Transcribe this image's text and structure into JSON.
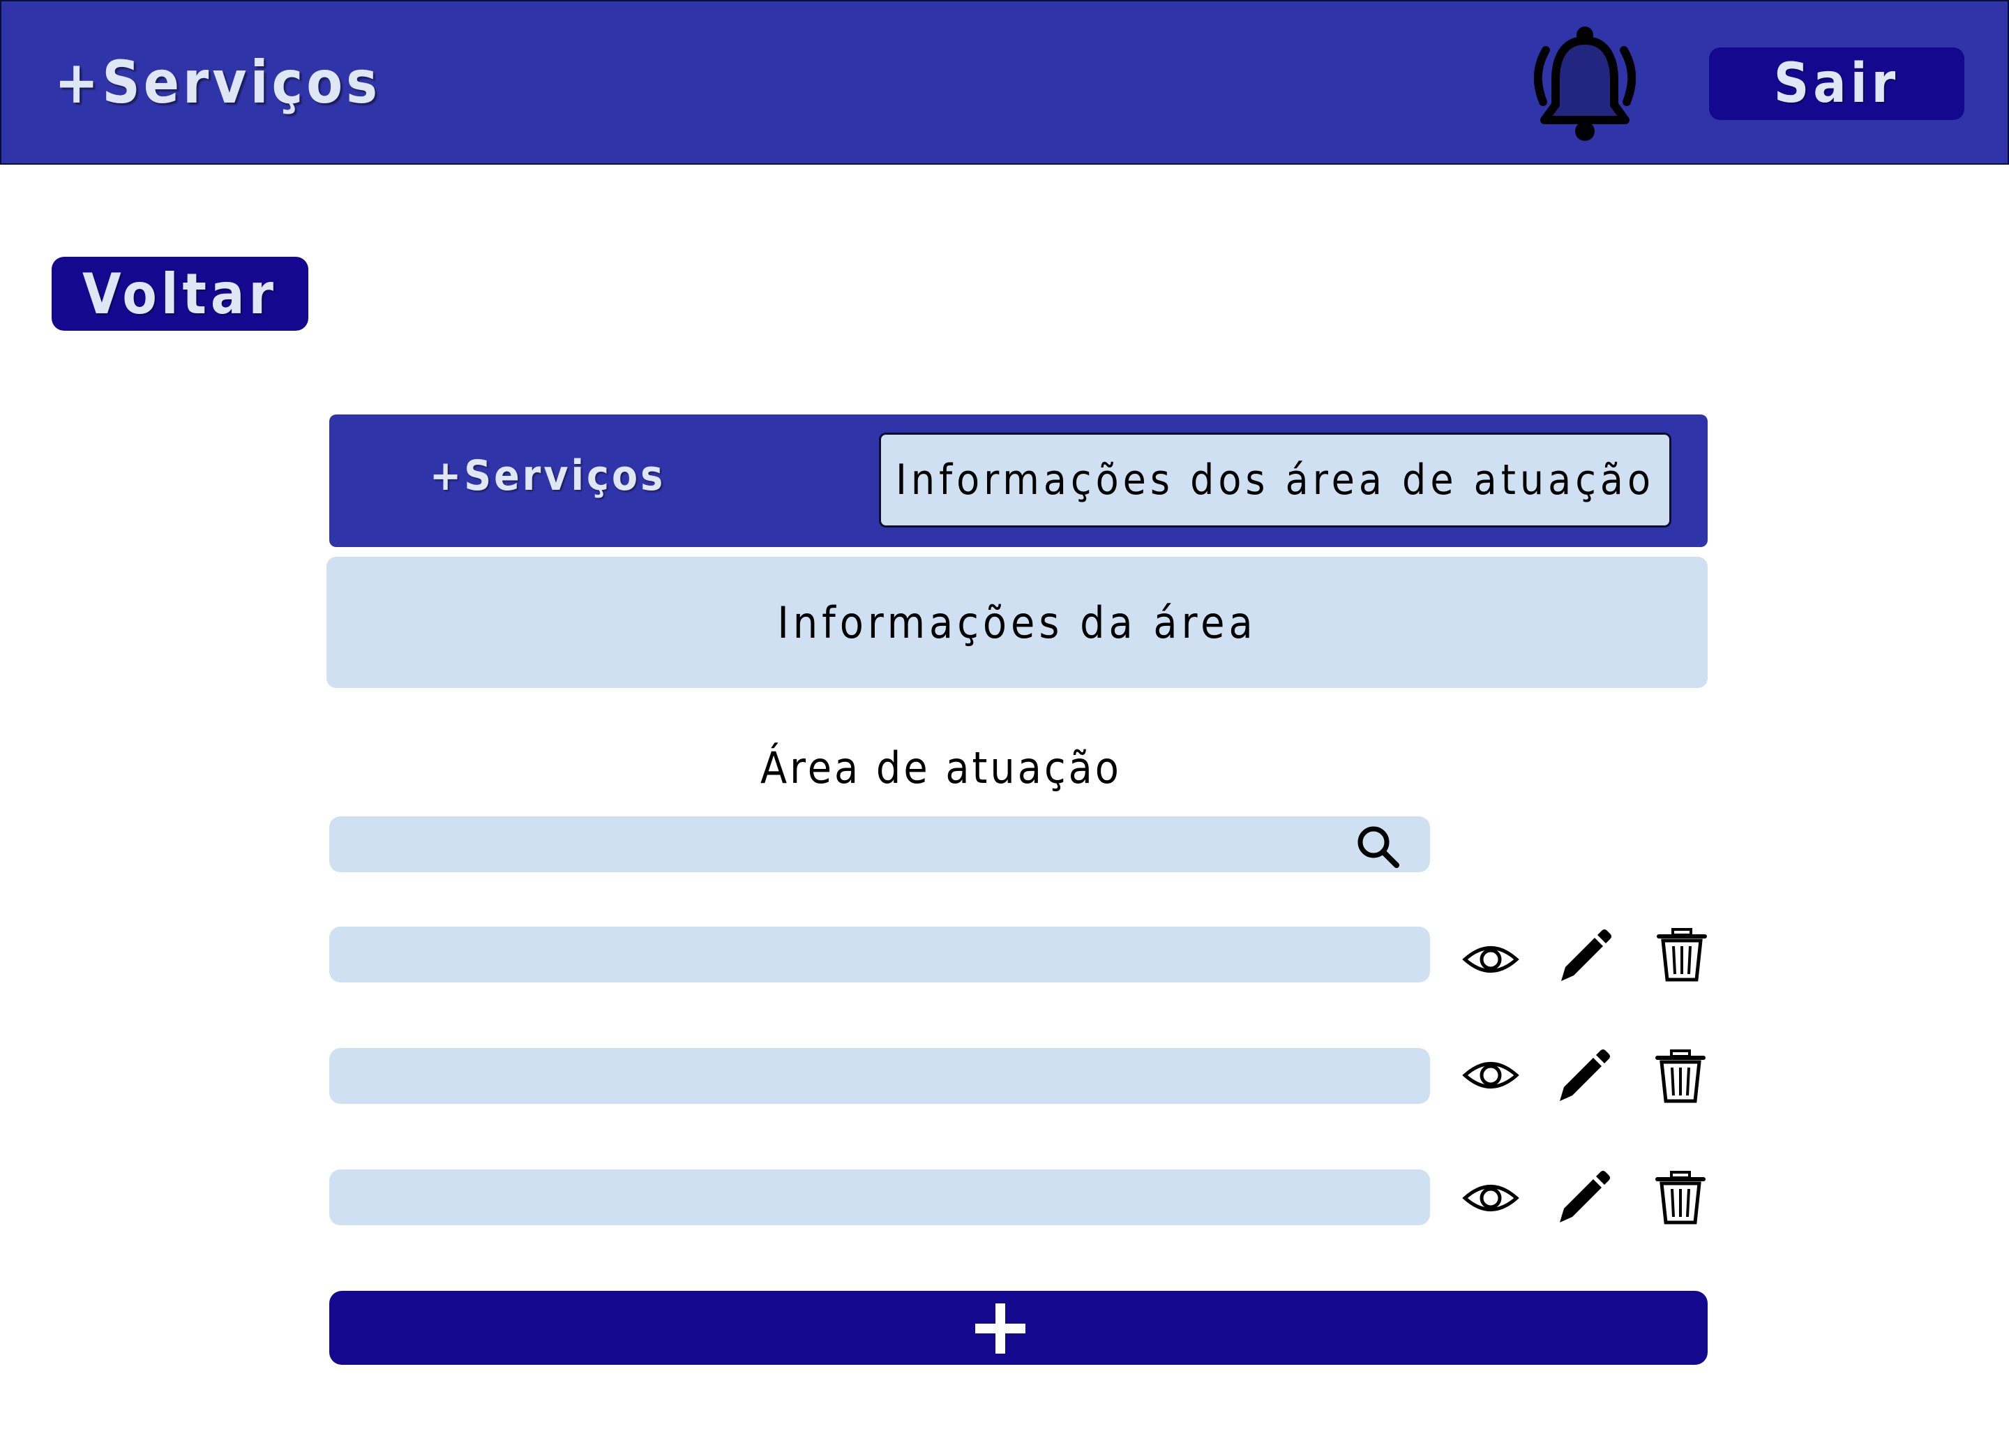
{
  "header": {
    "brand": "+Serviços",
    "logout_label": "Sair",
    "bell_icon": "bell-ringing-icon",
    "color": "#3034a9"
  },
  "back_button": {
    "label": "Voltar",
    "color": "#13088e"
  },
  "panel": {
    "brand": "+Serviços",
    "active_tab_label": "Informações dos área de atuação"
  },
  "section": {
    "title": "Informações da área",
    "field_label": "Área de atuação"
  },
  "search": {
    "value": "",
    "placeholder": "",
    "icon": "search-icon"
  },
  "rows": [
    {
      "value": "",
      "actions": [
        "eye-icon",
        "pencil-icon",
        "trash-icon"
      ]
    },
    {
      "value": "",
      "actions": [
        "eye-icon",
        "pencil-icon",
        "trash-icon"
      ]
    },
    {
      "value": "",
      "actions": [
        "eye-icon",
        "pencil-icon",
        "trash-icon"
      ]
    }
  ],
  "add_button": {
    "icon": "plus-icon"
  },
  "colors": {
    "primary": "#3034a9",
    "accent": "#13088e",
    "field": "#cfe0f2",
    "text_light": "#dfe7f5"
  }
}
